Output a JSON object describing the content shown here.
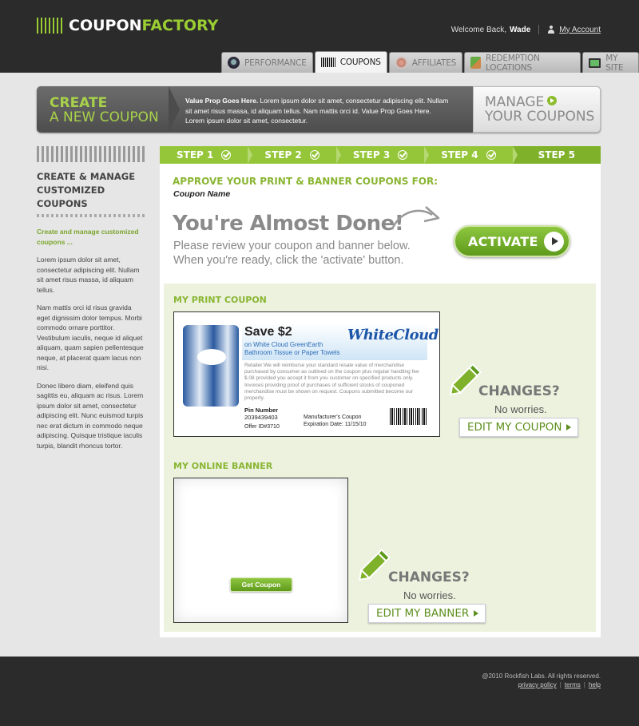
{
  "header": {
    "logo_a": "COUPON",
    "logo_b": "FACTORY",
    "welcome": "Welcome Back,",
    "user": "Wade",
    "my_account": "My Account",
    "tabs": [
      {
        "label": "PERFORMANCE",
        "icon": "performance-icon"
      },
      {
        "label": "COUPONS",
        "icon": "barcode-icon"
      },
      {
        "label": "AFFILIATES",
        "icon": "affiliates-icon"
      },
      {
        "label": "REDEMPTION LOCATIONS",
        "icon": "map-icon"
      },
      {
        "label": "MY SITE",
        "icon": "monitor-icon"
      }
    ]
  },
  "banner": {
    "create_1": "CREATE",
    "create_2": "A NEW COUPON",
    "vp_bold": "Value Prop Goes Here.",
    "vp_text": " Lorem ipsum dolor sit amet, consectetur adipiscing elit. Nullam sit amet risus massa, id aliquam tellus. Nam mattis orci id. Value Prop Goes Here. Lorem ipsum dolor sit amet, consectetur.",
    "manage_1": "MANAGE",
    "manage_2": "YOUR COUPONS"
  },
  "sidebar": {
    "title": "CREATE & MANAGE CUSTOMIZED COUPONS",
    "subtitle": "Create and manage customized coupons ...",
    "p1": "Lorem ipsum dolor sit amet, consectetur adipiscing elit. Nullam sit amet risus massa, id aliquam tellus.",
    "p2": "Nam mattis orci id risus gravida eget dignissim dolor tempus. Morbi commodo ornare porttitor. Vestibulum iaculis, neque id aliquet aliquam, quam sapien pellentesque neque, at placerat quam lacus non nisi.",
    "p3": "Donec libero diam, eleifend quis sagittis eu, aliquam ac risus. Lorem ipsum dolor sit amet, consectetur adipiscing elit. Nunc euismod turpis nec erat dictum in commodo neque adipiscing. Quisque tristique iaculis turpis, blandit rhoncus tortor."
  },
  "steps": [
    "STEP 1",
    "STEP 2",
    "STEP 3",
    "STEP 4",
    "STEP 5"
  ],
  "main": {
    "approve": "APPROVE YOUR PRINT & BANNER COUPONS FOR:",
    "coupon_name": "Coupon Name",
    "almost": "You're Almost Done!",
    "review_1": "Please review your coupon and banner below.",
    "review_2": "When you're ready, click the 'activate' button.",
    "activate": "ACTIVATE",
    "print_title": "MY PRINT COUPON",
    "banner_title": "MY ONLINE BANNER",
    "changes": "CHANGES?",
    "worries": "No worries.",
    "edit_coupon": "EDIT MY COUPON",
    "edit_banner": "EDIT MY BANNER",
    "get_coupon": "Get Coupon"
  },
  "coupon": {
    "save": "Save $2",
    "product_1": "on White Cloud GreenEarth",
    "product_2": "Bathroom Tissue or Paper Towels",
    "brand": "WhiteCloud",
    "fine": "Retailer:We will reimburse your standard resale value of merchandise purchased by consumer as outlined on the coupon plus regular handling fee $.08 provided you accept it from you customer on specified products only. Invoices providing proof of purchases of sufficient stocks of couponed merchandise must be shown on request. Coupons submitted become our property.",
    "pin_label": "Pin Number",
    "pin": "2039439403",
    "offer": "Offer ID#3710",
    "mfr": "Manufacturer's Coupon",
    "exp": "Expiration Date: 11/15/10"
  },
  "footer": {
    "copyright": "@2010 Rockfish Labs. All rights reserved.",
    "privacy": "privacy policy",
    "terms": "terms",
    "help": "help"
  },
  "colors": {
    "accent": "#8ab634",
    "dark": "#2b2b2b"
  }
}
